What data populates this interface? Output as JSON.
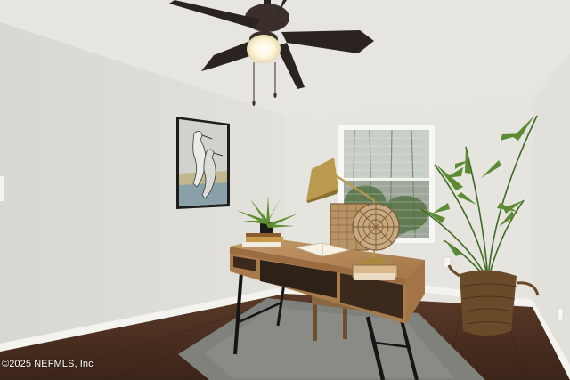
{
  "photo": {
    "subject": "home-office-room",
    "watermark": "©2025 NEFMLS, Inc"
  },
  "colors": {
    "ceiling": "#e6e5e1",
    "left_wall": "#dedcd6",
    "right_wall": "#e4e2dc",
    "floor": "#4a2e1f",
    "baseboard": "#f4f3ef",
    "desk_top": "#b88a5a",
    "fan_blade": "#2b2320",
    "brass": "#b99a4e",
    "rug": "#7d7f7a",
    "plant_green": "#4f7a2c"
  }
}
